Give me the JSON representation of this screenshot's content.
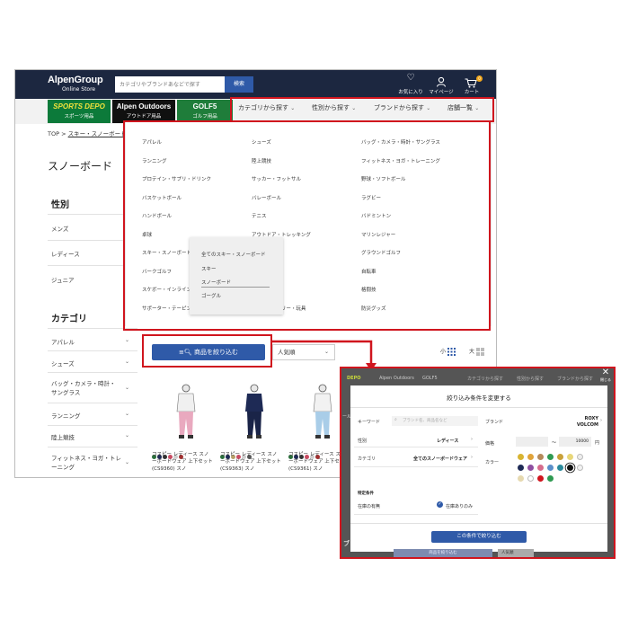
{
  "header": {
    "logo_main": "AlpenGroup",
    "logo_sub": "Online Store",
    "search_placeholder": "カテゴリやブランドあなどで探す",
    "search_button": "検索",
    "favorites_label": "お気に入り",
    "mypage_label": "マイページ",
    "cart_label": "カート",
    "cart_count": "0"
  },
  "shops": [
    {
      "name": "SPORTS DEPO",
      "sub": "スポーツ用品",
      "color": "#0c7a3a"
    },
    {
      "name": "Alpen Outdoors",
      "sub": "アウトドア用品",
      "color": "#101010"
    },
    {
      "name": "GOLF5",
      "sub": "ゴルフ用品",
      "color": "#1f7d3a"
    }
  ],
  "nav": {
    "category": "カテゴリから探す",
    "gender": "性別から探す",
    "brand": "ブランドから探す",
    "stores": "店舗一覧"
  },
  "breadcrumb": {
    "top": "TOP",
    "sep": ">",
    "current": "スキー・スノーボード"
  },
  "page_title": "スノーボード",
  "sidebar": {
    "gender_head": "性別",
    "gender_items": [
      "メンズ",
      "レディース",
      "ジュニア"
    ],
    "category_head": "カテゴリ",
    "category_items": [
      "アパレル",
      "シューズ",
      "バッグ・カメラ・時計・サングラス",
      "ランニング",
      "陸上競技",
      "フィットネス・ヨガ・トレーニング"
    ]
  },
  "megamenu": {
    "col1": [
      "アパレル",
      "ランニング",
      "プロテイン・サプリ・ドリンク",
      "バスケットボール",
      "ハンドボール",
      "卓球",
      "スキー・スノーボード",
      "バークゴルフ",
      "スケボー・インライン",
      "サポーター・テーピング"
    ],
    "col2": [
      "シューズ",
      "陸上競技",
      "サッカー・フットサル",
      "バレーボール",
      "テニス",
      "アウトドア・トレッキング",
      "",
      "",
      "",
      "ステーショナリー・玩具"
    ],
    "col3": [
      "バッグ・カメラ・時計・サングラス",
      "フィットネス・ヨガ・トレーニング",
      "野球・ソフトボール",
      "ラグビー",
      "バドミントン",
      "マリンレジャー",
      "グラウンドゴルフ",
      "自転車",
      "格闘技",
      "防災グッズ"
    ],
    "submenu": [
      "全てのスキー・スノーボード",
      "スキー",
      "スノーボード",
      "ゴーグル"
    ]
  },
  "toolbar": {
    "filter_button": "商品を絞り込む",
    "sort_value": "人気順",
    "view_small": "小",
    "view_large": "大"
  },
  "products": [
    {
      "name": "コスピー レディース スノーボードウェア 上下セット (CS9360) スノ",
      "colors": [
        "#2b6f3c",
        "#1e2a55",
        "#333333",
        "#c94b62",
        "#cfcfcf",
        "#a03030"
      ]
    },
    {
      "name": "コスピー レディース スノーボードウェア 上下セット (CS9363) スノ",
      "colors": [
        "#2b6f3c",
        "#1e2a55",
        "#b8a06a",
        "#c94b62",
        "#cfcfcf",
        "#555555"
      ]
    },
    {
      "name": "コスピー レディース スノーボードウェア 上下セット (CS9361) スノ",
      "colors": [
        "#2b6f3c",
        "#1e2a55",
        "#333333",
        "#c94b62",
        "#cfcfcf",
        "#a03030"
      ]
    }
  ],
  "callout": {
    "title": "絞り込み条件を変更する",
    "close": "閉じる",
    "keyword_label": "キーワード",
    "keyword_placeholder": "ブランド名、商品名など",
    "brand_label": "ブランド",
    "brand_value_1": "ROXY",
    "brand_value_2": "VOLCOM",
    "gender_label": "性別",
    "gender_value": "レディース",
    "price_label": "価格",
    "price_sep": "〜",
    "price_max": "10000",
    "price_unit": "円",
    "category_label": "カテゴリ",
    "category_value": "全てのスノーボードウェア",
    "color_label": "カラー",
    "special_label": "特定条件",
    "stock_label": "在庫の有無",
    "stock_value": "在庫ありのみ",
    "apply_button": "この条件で絞り込む",
    "bg_nav": [
      "DEPO",
      "Alpen Outdoors",
      "GOLF5",
      "カテゴリから探す",
      "性別から探す",
      "ブランドから探す"
    ],
    "bg_filter": "商品を絞り込む",
    "bg_sort": "人気順",
    "bg_left_1": "ブ",
    "bg_left_2": "ール",
    "colors": [
      "#d8b431",
      "#e0a33a",
      "#b58a5a",
      "#2f9a52",
      "#c9a13a",
      "#e8d77a",
      "#ededed",
      "#1e2a55",
      "#8e4fa0",
      "#d66c8c",
      "#5b8fc9",
      "#2a8a9c",
      "#111111",
      "#f2f2f2",
      "#e6d9b0",
      "#ffffff",
      "#d0151e",
      "#2f9a52"
    ]
  }
}
